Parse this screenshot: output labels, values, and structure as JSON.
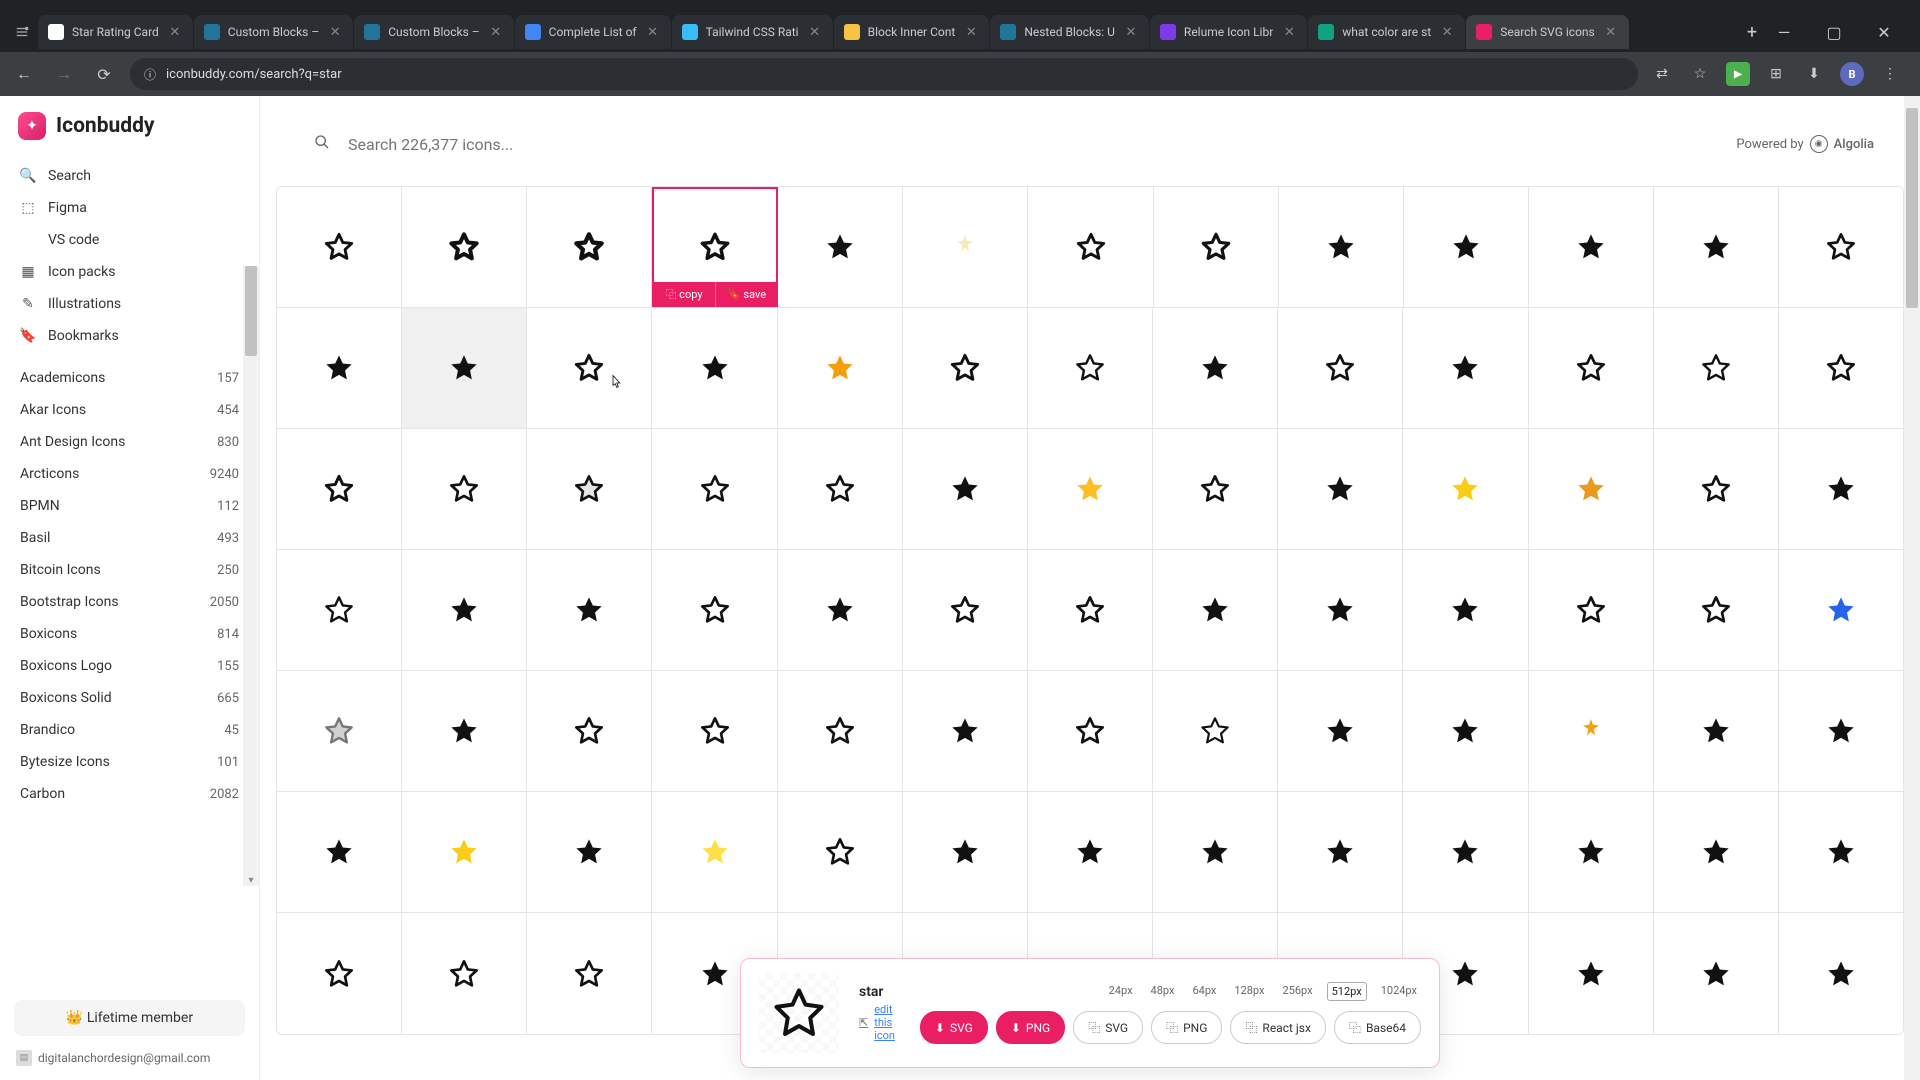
{
  "browser": {
    "tabs": [
      {
        "label": "Star Rating Card",
        "fav": "#fff"
      },
      {
        "label": "Custom Blocks –",
        "fav": "#21759b"
      },
      {
        "label": "Custom Blocks –",
        "fav": "#21759b"
      },
      {
        "label": "Complete List of",
        "fav": "#4285f4"
      },
      {
        "label": "Tailwind CSS Rati",
        "fav": "#38bdf8"
      },
      {
        "label": "Block Inner Cont",
        "fav": "#f6c344"
      },
      {
        "label": "Nested Blocks: U",
        "fav": "#21759b"
      },
      {
        "label": "Relume Icon Libr",
        "fav": "#7c3aed"
      },
      {
        "label": "what color are st",
        "fav": "#10a37f"
      },
      {
        "label": "Search SVG icons",
        "fav": "#e91e63",
        "active": true
      }
    ],
    "url": "iconbuddy.com/search?q=star",
    "profile_letter": "B"
  },
  "sidebar": {
    "brand": "Iconbuddy",
    "nav": [
      {
        "icon": "🔍",
        "label": "Search"
      },
      {
        "icon": "⬚",
        "label": "Figma"
      },
      {
        "icon": "</>",
        "label": "VS code"
      },
      {
        "icon": "▦",
        "label": "Icon packs"
      },
      {
        "icon": "✎",
        "label": "Illustrations"
      },
      {
        "icon": "🔖",
        "label": "Bookmarks"
      }
    ],
    "packs": [
      {
        "name": "Academicons",
        "count": "157"
      },
      {
        "name": "Akar Icons",
        "count": "454"
      },
      {
        "name": "Ant Design Icons",
        "count": "830"
      },
      {
        "name": "Arcticons",
        "count": "9240"
      },
      {
        "name": "BPMN",
        "count": "112"
      },
      {
        "name": "Basil",
        "count": "493"
      },
      {
        "name": "Bitcoin Icons",
        "count": "250"
      },
      {
        "name": "Bootstrap Icons",
        "count": "2050"
      },
      {
        "name": "Boxicons",
        "count": "814"
      },
      {
        "name": "Boxicons Logo",
        "count": "155"
      },
      {
        "name": "Boxicons Solid",
        "count": "665"
      },
      {
        "name": "Brandico",
        "count": "45"
      },
      {
        "name": "Bytesize Icons",
        "count": "101"
      },
      {
        "name": "Carbon",
        "count": "2082"
      }
    ],
    "lifetime": "👑 Lifetime member",
    "email": "digitalanchordesign@gmail.com"
  },
  "search": {
    "placeholder": "Search 226,377 icons...",
    "powered_label": "Powered by",
    "powered_name": "Algolia"
  },
  "grid": {
    "copy_label": "copy",
    "save_label": "save",
    "rows": [
      [
        {
          "style": "outline",
          "fill": "none",
          "stroke": "#111",
          "sw": 2.2
        },
        {
          "style": "outline",
          "fill": "none",
          "stroke": "#111",
          "sw": 3.0
        },
        {
          "style": "outline",
          "fill": "none",
          "stroke": "#111",
          "sw": 3.2
        },
        {
          "style": "outline",
          "fill": "none",
          "stroke": "#111",
          "sw": 2.6,
          "selected": true
        },
        {
          "style": "solid",
          "fill": "#111",
          "scale": 0.78
        },
        {
          "style": "sparkle",
          "fill": "#f7e9b8"
        },
        {
          "style": "outline",
          "fill": "none",
          "stroke": "#111",
          "sw": 2.2
        },
        {
          "style": "outline",
          "fill": "none",
          "stroke": "#111",
          "sw": 2.4
        },
        {
          "style": "solid",
          "fill": "#111"
        },
        {
          "style": "solid",
          "fill": "#111"
        },
        {
          "style": "solid",
          "fill": "#111"
        },
        {
          "style": "solid",
          "fill": "#111"
        },
        {
          "style": "outline",
          "fill": "none",
          "stroke": "#111",
          "sw": 2.0
        }
      ],
      [
        {
          "style": "solid",
          "fill": "#111"
        },
        {
          "style": "solid",
          "fill": "#111",
          "hover": true
        },
        {
          "style": "outline",
          "fill": "none",
          "stroke": "#111",
          "sw": 2.2
        },
        {
          "style": "solid",
          "fill": "#111",
          "scale": 0.85
        },
        {
          "style": "solid",
          "fill": "#f59e0b"
        },
        {
          "style": "outline",
          "fill": "none",
          "stroke": "#111",
          "sw": 2.2
        },
        {
          "style": "outline",
          "fill": "none",
          "stroke": "#111",
          "sw": 1.8
        },
        {
          "style": "solid",
          "fill": "#111"
        },
        {
          "style": "outline",
          "fill": "none",
          "stroke": "#111",
          "sw": 2.0
        },
        {
          "style": "solid",
          "fill": "#111"
        },
        {
          "style": "outline",
          "fill": "none",
          "stroke": "#111",
          "sw": 2.0
        },
        {
          "style": "outline",
          "fill": "none",
          "stroke": "#111",
          "sw": 1.8
        },
        {
          "style": "outline",
          "fill": "none",
          "stroke": "#111",
          "sw": 2.0
        }
      ],
      [
        {
          "style": "outline",
          "fill": "none",
          "stroke": "#111",
          "sw": 2.2
        },
        {
          "style": "outline",
          "fill": "none",
          "stroke": "#111",
          "sw": 2.0
        },
        {
          "style": "outline",
          "fill": "#e5e5e5",
          "stroke": "#111",
          "sw": 2.0
        },
        {
          "style": "outline",
          "fill": "none",
          "stroke": "#111",
          "sw": 2.0
        },
        {
          "style": "outline",
          "fill": "none",
          "stroke": "#111",
          "sw": 2.0
        },
        {
          "style": "solid",
          "fill": "#111"
        },
        {
          "style": "solid",
          "fill": "#fbbf24",
          "scale": 0.8
        },
        {
          "style": "outline",
          "fill": "none",
          "stroke": "#111",
          "sw": 2.0
        },
        {
          "style": "solid",
          "fill": "#111"
        },
        {
          "style": "solid",
          "fill": "#facc15"
        },
        {
          "style": "solid",
          "fill": "#ea9a1e"
        },
        {
          "style": "outline",
          "fill": "none",
          "stroke": "#111",
          "sw": 2.0
        },
        {
          "style": "solid",
          "fill": "#111"
        }
      ],
      [
        {
          "style": "outline",
          "fill": "none",
          "stroke": "#111",
          "sw": 1.8,
          "scale": 0.85
        },
        {
          "style": "solid",
          "fill": "#111"
        },
        {
          "style": "solid",
          "fill": "#111"
        },
        {
          "style": "outline",
          "fill": "none",
          "stroke": "#111",
          "sw": 2.0
        },
        {
          "style": "solid",
          "fill": "#111"
        },
        {
          "style": "outline",
          "fill": "none",
          "stroke": "#111",
          "sw": 2.0
        },
        {
          "style": "outline",
          "fill": "none",
          "stroke": "#111",
          "sw": 2.0
        },
        {
          "style": "solid",
          "fill": "#111"
        },
        {
          "style": "solid",
          "fill": "#111"
        },
        {
          "style": "solid",
          "fill": "#111"
        },
        {
          "style": "outline",
          "fill": "none",
          "stroke": "#111",
          "sw": 2.0
        },
        {
          "style": "outline",
          "fill": "none",
          "stroke": "#111",
          "sw": 2.0
        },
        {
          "style": "solid",
          "fill": "#2563eb",
          "stroke": "#1e40af"
        }
      ],
      [
        {
          "style": "outline",
          "fill": "#d1d1d1",
          "stroke": "#777",
          "sw": 1.8
        },
        {
          "style": "solid",
          "fill": "#111"
        },
        {
          "style": "outline",
          "fill": "none",
          "stroke": "#111",
          "sw": 2.0
        },
        {
          "style": "outline",
          "fill": "none",
          "stroke": "#111",
          "sw": 2.0
        },
        {
          "style": "outline",
          "fill": "none",
          "stroke": "#111",
          "sw": 2.0
        },
        {
          "style": "solid",
          "fill": "#111"
        },
        {
          "style": "outline",
          "fill": "none",
          "stroke": "#111",
          "sw": 2.0
        },
        {
          "style": "outline",
          "fill": "none",
          "stroke": "#111",
          "sw": 1.6,
          "scale": 0.88
        },
        {
          "style": "solid",
          "fill": "#111"
        },
        {
          "style": "solid",
          "fill": "#111",
          "scale": 0.9
        },
        {
          "style": "sparkle",
          "fill": "#f59e0b"
        },
        {
          "style": "solid",
          "fill": "#111"
        },
        {
          "style": "solid",
          "fill": "#111"
        }
      ],
      [
        {
          "style": "solid",
          "fill": "#111"
        },
        {
          "style": "solid",
          "fill": "#facc15",
          "rounded": true
        },
        {
          "style": "solid",
          "fill": "#111"
        },
        {
          "style": "solid",
          "fill": "#fde047",
          "scale": 0.85
        },
        {
          "style": "outline",
          "fill": "none",
          "stroke": "#111",
          "sw": 2.0
        },
        {
          "style": "solid",
          "fill": "#111",
          "scale": 0.9
        },
        {
          "style": "solid",
          "fill": "#111"
        },
        {
          "style": "solid",
          "fill": "#111"
        },
        {
          "style": "solid",
          "fill": "#111"
        },
        {
          "style": "solid",
          "fill": "#111"
        },
        {
          "style": "solid",
          "fill": "#111"
        },
        {
          "style": "solid",
          "fill": "#111"
        },
        {
          "style": "solid",
          "fill": "#111"
        }
      ],
      [
        {
          "style": "outline",
          "fill": "none",
          "stroke": "#111",
          "sw": 2.0
        },
        {
          "style": "outline",
          "fill": "none",
          "stroke": "#111",
          "sw": 2.0
        },
        {
          "style": "outline",
          "fill": "none",
          "stroke": "#111",
          "sw": 2.0
        },
        {
          "style": "solid",
          "fill": "#111"
        },
        {
          "style": "solid",
          "fill": "#111"
        },
        {
          "style": "solid",
          "fill": "#111"
        },
        {
          "style": "solid",
          "fill": "#111"
        },
        {
          "style": "solid",
          "fill": "#111"
        },
        {
          "style": "solid",
          "fill": "#111"
        },
        {
          "style": "solid",
          "fill": "#111"
        },
        {
          "style": "solid",
          "fill": "#111"
        },
        {
          "style": "solid",
          "fill": "#111"
        },
        {
          "style": "solid",
          "fill": "#111"
        }
      ]
    ]
  },
  "detail": {
    "title": "star",
    "edit_icon": "⇱",
    "edit_label": "edit this icon",
    "sizes": [
      "24px",
      "48px",
      "64px",
      "128px",
      "256px",
      "512px",
      "1024px"
    ],
    "selected_size": "512px",
    "buttons": [
      {
        "label": "SVG",
        "icon": "⬇",
        "pink": true
      },
      {
        "label": "PNG",
        "icon": "⬇",
        "pink": true
      },
      {
        "label": "SVG",
        "icon": "⿻",
        "pink": false
      },
      {
        "label": "PNG",
        "icon": "⿻",
        "pink": false
      },
      {
        "label": "React jsx",
        "icon": "⿻",
        "pink": false
      },
      {
        "label": "Base64",
        "icon": "⿻",
        "pink": false
      }
    ]
  }
}
